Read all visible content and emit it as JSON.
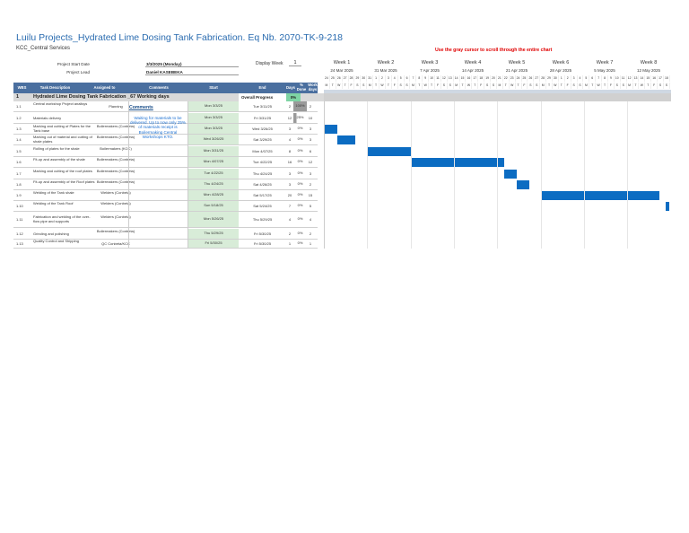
{
  "title": "Luilu Projects_Hydrated Lime Dosing Tank Fabrication. Eq Nb. 2070-TK-9-218",
  "subtitle": "KCC_Central Services",
  "hint": "Use the gray cursor to scroll through the entire chart",
  "meta": {
    "start_label": "Project Start Date",
    "start_value": "3/3/2025 (Monday)",
    "lead_label": "Project Lead",
    "lead_value": "Daniel KASEBEKA",
    "display_week_label": "Display Week",
    "display_week_value": "1"
  },
  "weeks": [
    {
      "label": "Week 1",
      "date": "24 Mar 2025"
    },
    {
      "label": "Week 2",
      "date": "31 Mar 2025"
    },
    {
      "label": "Week 3",
      "date": "7 Apr 2025"
    },
    {
      "label": "Week 4",
      "date": "14 Apr 2025"
    },
    {
      "label": "Week 5",
      "date": "21 Apr 2025"
    },
    {
      "label": "Week 6",
      "date": "28 Apr 2025"
    },
    {
      "label": "Week 7",
      "date": "5 May 2025"
    },
    {
      "label": "Week 8",
      "date": "12 May 2025"
    }
  ],
  "day_numbers": [
    "24",
    "25",
    "26",
    "27",
    "28",
    "29",
    "30",
    "31",
    "1",
    "2",
    "3",
    "4",
    "5",
    "6",
    "7",
    "8",
    "9",
    "10",
    "11",
    "12",
    "13",
    "14",
    "15",
    "16",
    "17",
    "18",
    "19",
    "20",
    "21",
    "22",
    "23",
    "24",
    "25",
    "26",
    "27",
    "28",
    "29",
    "30",
    "1",
    "2",
    "3",
    "4",
    "5",
    "6",
    "7",
    "8",
    "9",
    "10",
    "11",
    "12",
    "13",
    "14",
    "15",
    "16",
    "17",
    "18"
  ],
  "day_letters": [
    "M",
    "T",
    "W",
    "T",
    "F",
    "S",
    "S",
    "M",
    "T",
    "W",
    "T",
    "F",
    "S",
    "S",
    "M",
    "T",
    "W",
    "T",
    "F",
    "S",
    "S",
    "M",
    "T",
    "W",
    "T",
    "F",
    "S",
    "S",
    "M",
    "T",
    "W",
    "T",
    "F",
    "S",
    "S",
    "M",
    "T",
    "W",
    "T",
    "F",
    "S",
    "S",
    "M",
    "T",
    "W",
    "T",
    "F",
    "S",
    "S",
    "M",
    "T",
    "W",
    "T",
    "F",
    "S",
    "S"
  ],
  "columns": {
    "wbs": "WBS",
    "task": "Task Description",
    "assigned": "Assigned to",
    "comments": "Comments",
    "start": "Start",
    "end": "End",
    "days": "Days",
    "done": "% Done",
    "work_days": "Work days"
  },
  "section": {
    "wbs": "1",
    "title": "Hydrated Lime Dosing Tank Fabrication _67 Working days",
    "progress_label": "Overall Progress",
    "progress_value": "0%"
  },
  "comments": {
    "heading": "Comments",
    "text": "Waiting for materials to be delivered. Up to now only 25% of materials receipt is Boilermaking Central Workshops KTO."
  },
  "tasks": [
    {
      "wbs": "1.1",
      "task": "Central workshop Project analisys",
      "assigned": "Planning",
      "start": "Mon 3/3/25",
      "end": "Tue 3/11/25",
      "days": "2",
      "done": "100%",
      "work_days": "2",
      "done_fill": 1.0
    },
    {
      "wbs": "1.2",
      "task": "Materials delivery",
      "assigned": "",
      "start": "Mon 3/3/25",
      "end": "Fri 3/31/25",
      "days": "12",
      "done": "25%",
      "work_days": "10",
      "done_fill": 0.25
    },
    {
      "wbs": "1.3",
      "task": "Marking and cutting of Plates for the Tank base",
      "assigned": "Boilermakers (Conbeta)",
      "start": "Mon 3/3/25",
      "end": "Wed 3/26/25",
      "days": "3",
      "done": "0%",
      "work_days": "3",
      "done_fill": 0
    },
    {
      "wbs": "1.4",
      "task": "Marking out of material and cutting of shale plates",
      "assigned": "Boilermakers (Conbeta)",
      "start": "Wed 3/26/25",
      "end": "Sat 3/29/25",
      "days": "4",
      "done": "0%",
      "work_days": "3",
      "done_fill": 0
    },
    {
      "wbs": "1.5",
      "task": "Rolling of plates for the shale",
      "assigned": "Boilermakers (KCC)",
      "start": "Mon 3/31/25",
      "end": "Mon 4/07/25",
      "days": "8",
      "done": "0%",
      "work_days": "6",
      "done_fill": 0
    },
    {
      "wbs": "1.6",
      "task": "Fit-up and assembly of the shale",
      "assigned": "Boilermakers (Conbeta)",
      "start": "Mon 4/07/25",
      "end": "Tue 4/22/25",
      "days": "16",
      "done": "0%",
      "work_days": "12",
      "done_fill": 0
    },
    {
      "wbs": "1.7",
      "task": "Marking and cutting of the roof plates",
      "assigned": "Boilermakers (Conbeta)",
      "start": "Tue 4/22/25",
      "end": "Thu 4/24/25",
      "days": "3",
      "done": "0%",
      "work_days": "3",
      "done_fill": 0
    },
    {
      "wbs": "1.8",
      "task": "Fit-up and assembly of the Roof plates",
      "assigned": "Boilermakers (Conbeta)",
      "start": "Thu 4/24/25",
      "end": "Sat 4/26/25",
      "days": "3",
      "done": "0%",
      "work_days": "2",
      "done_fill": 0
    },
    {
      "wbs": "1.9",
      "task": "Welding of the Tank shale",
      "assigned": "Welders (Conbeta)",
      "start": "Mon 4/28/25",
      "end": "Sat 5/17/25",
      "days": "20",
      "done": "0%",
      "work_days": "15",
      "done_fill": 0
    },
    {
      "wbs": "1.10",
      "task": "Welding of the Tank Roof",
      "assigned": "Welders (Conbeta)",
      "start": "Sun 5/18/25",
      "end": "Sat 5/24/25",
      "days": "7",
      "done": "0%",
      "work_days": "5",
      "done_fill": 0
    },
    {
      "wbs": "1.11",
      "task": "Fabrication and welding of the over-flow pipe and supports",
      "assigned": "Welders (Conbeta)",
      "start": "Mon 5/26/25",
      "end": "Thu 5/29/25",
      "days": "4",
      "done": "0%",
      "work_days": "4",
      "done_fill": 0
    },
    {
      "wbs": "1.12",
      "task": "Grinding and polishing",
      "assigned": "Boilermakers (Conbeta)",
      "start": "Thu 5/29/25",
      "end": "Fri 5/30/25",
      "days": "2",
      "done": "0%",
      "work_days": "2",
      "done_fill": 0
    },
    {
      "wbs": "1.13",
      "task": "Quality Control and Shipping",
      "assigned": "QC Conbeta/KCC",
      "start": "Fri 5/30/25",
      "end": "Fri 5/30/25",
      "days": "1",
      "done": "0%",
      "work_days": "1",
      "done_fill": 0
    }
  ],
  "chart_data": {
    "type": "gantt",
    "bar_color": "#0b6cc2",
    "x_start": "2025-03-24",
    "x_end": "2025-05-18",
    "bars": [
      {
        "task": "1.3",
        "start": "2025-03-24",
        "end": "2025-03-26"
      },
      {
        "task": "1.4",
        "start": "2025-03-26",
        "end": "2025-03-29"
      },
      {
        "task": "1.5",
        "start": "2025-03-31",
        "end": "2025-04-07"
      },
      {
        "task": "1.6",
        "start": "2025-04-07",
        "end": "2025-04-22"
      },
      {
        "task": "1.7",
        "start": "2025-04-22",
        "end": "2025-04-24"
      },
      {
        "task": "1.8",
        "start": "2025-04-24",
        "end": "2025-04-26"
      },
      {
        "task": "1.9",
        "start": "2025-04-28",
        "end": "2025-05-17"
      },
      {
        "task": "1.10",
        "start": "2025-05-18",
        "end": "2025-05-18"
      }
    ]
  }
}
